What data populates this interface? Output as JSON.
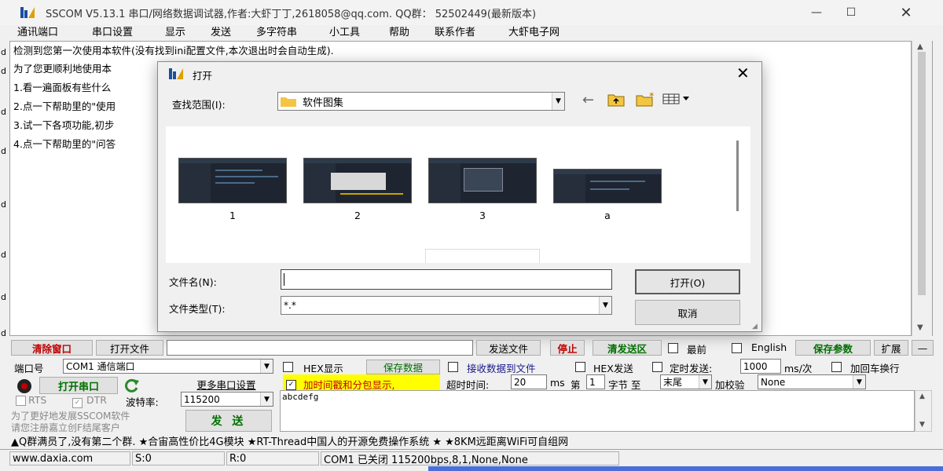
{
  "app": {
    "title": "SSCOM V5.13.1 串口/网络数据调试器,作者:大虾丁丁,2618058@qq.com. QQ群： 52502449(最新版本)",
    "menu": [
      "通讯端口",
      "串口设置",
      "显示",
      "发送",
      "多字符串",
      "小工具",
      "帮助",
      "联系作者",
      "大虾电子网"
    ]
  },
  "receive": {
    "lines": [
      "检测到您第一次使用本软件(没有找到ini配置文件,本次退出时会自动生成).",
      "为了您更顺利地使用本",
      "1.看一遍面板有些什么",
      "2.点一下帮助里的\"使用",
      "3.试一下各项功能,初步",
      "4.点一下帮助里的\"问答"
    ],
    "left_labels": [
      "d",
      "d",
      "d",
      "d",
      "d",
      "d",
      "d",
      "d"
    ]
  },
  "dialog": {
    "title": "打开",
    "lookin_label": "查找范围(I):",
    "lookin_value": "软件图集",
    "files": [
      {
        "name": "1"
      },
      {
        "name": "2"
      },
      {
        "name": "3"
      },
      {
        "name": "a"
      }
    ],
    "filename_label": "文件名(N):",
    "filename_value": "",
    "filetype_label": "文件类型(T):",
    "filetype_value": "*.*",
    "open_button": "打开(O)",
    "cancel_button": "取消"
  },
  "toolbar": {
    "clear_window": "清除窗口",
    "open_file": "打开文件",
    "send_file": "发送文件",
    "stop": "停止",
    "clear_send": "清发送区",
    "front": "最前",
    "english": "English",
    "save_params": "保存参数",
    "expand": "扩展",
    "collapse": "—"
  },
  "port": {
    "port_label": "端口号",
    "port_value": "COM1 通信端口",
    "open_port": "打开串口",
    "more_settings": "更多串口设置",
    "rts": "RTS",
    "dtr": "DTR",
    "baud_label": "波特率:",
    "baud_value": "115200",
    "promo": [
      "为了更好地发展SSCOM软件",
      "请您注册嘉立创F结尾客户"
    ],
    "send": "发 送"
  },
  "options": {
    "hex_display": "HEX显示",
    "save_data": "保存数据",
    "recv_to_file": "接收数据到文件",
    "hex_send": "HEX发送",
    "timed_send": "定时发送:",
    "interval": "1000",
    "interval_unit": "ms/次",
    "add_crlf": "加回车换行",
    "timestamp": "加时间戳和分包显示,",
    "timeout_label": "超时时间:",
    "timeout_value": "20",
    "ms": "ms",
    "byte_label": "第",
    "byte_value": "1",
    "byte_unit": "字节 至",
    "end_value": "末尾",
    "checksum_label": "加校验",
    "checksum_value": "None"
  },
  "send_text": "abcdefg",
  "ticker": "▲Q群满员了,没有第二个群. ★合宙高性价比4G模块 ★RT-Thread中国人的开源免费操作系统 ★ ★8KM远距离WiFi可自组网",
  "status": {
    "website": "www.daxia.com",
    "s": "S:0",
    "r": "R:0",
    "port_state": "COM1 已关闭  115200bps,8,1,None,None"
  }
}
